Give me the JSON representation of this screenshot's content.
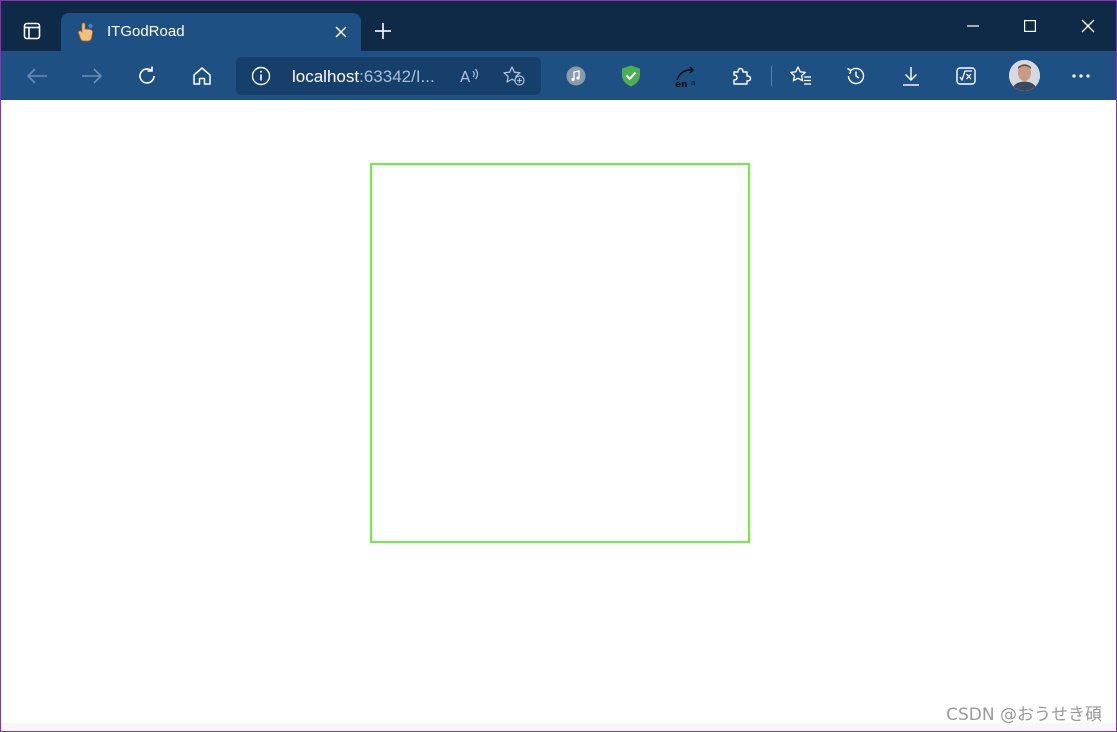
{
  "browser": {
    "tab": {
      "title": "ITGodRoad",
      "favicon": "hand-pointer-icon",
      "close_icon": "close-icon"
    },
    "new_tab_icon": "plus-icon",
    "window_controls": [
      "minimize-icon",
      "maximize-icon",
      "close-icon"
    ],
    "toolbar": {
      "nav": [
        "back-arrow-icon",
        "forward-arrow-icon",
        "refresh-icon",
        "home-icon"
      ],
      "address": {
        "host": "localhost",
        "rest": ":63342/I..."
      },
      "address_icons": [
        "read-aloud-icon",
        "add-favorite-icon"
      ],
      "extensions": [
        "music-extension-icon",
        "shield-check-extension-icon",
        "translate-extension-icon",
        "extensions-puzzle-icon"
      ],
      "right_icons": [
        "favorites-icon",
        "history-icon",
        "downloads-icon",
        "math-solver-icon",
        "profile-avatar",
        "more-menu-icon"
      ]
    }
  },
  "page": {
    "box_color": "#6cf23a"
  },
  "watermark": "CSDN @おうせき碩",
  "colors": {
    "titlebar": "#0f2a47",
    "toolbar": "#1f5083",
    "address_bg": "#163f6b",
    "window_border": "#8e2fb3"
  }
}
